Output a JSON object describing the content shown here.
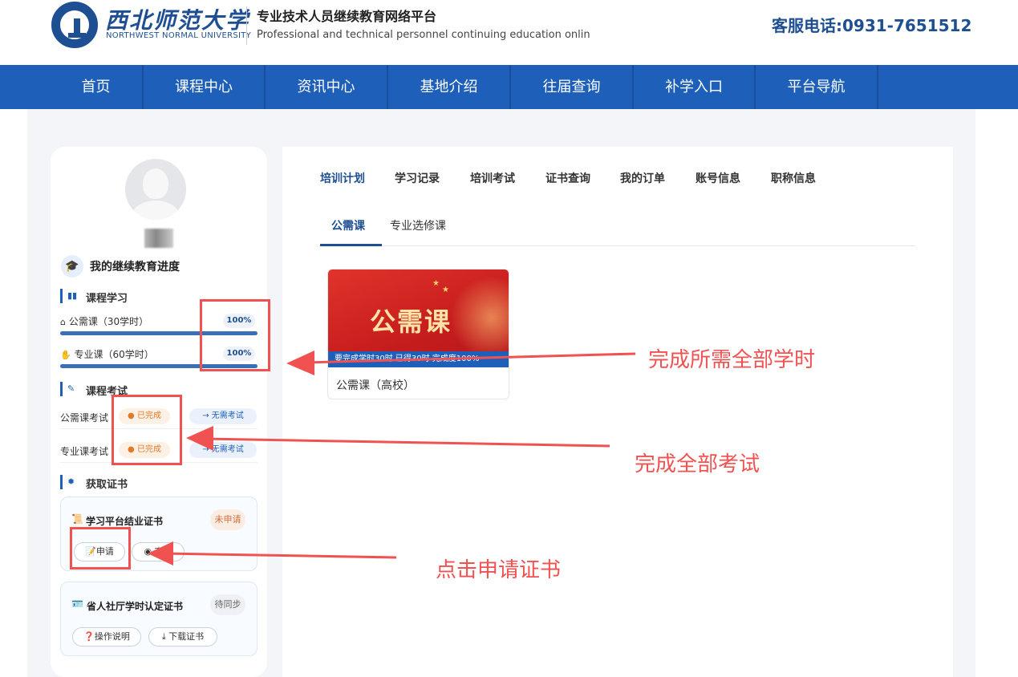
{
  "header": {
    "logo_name_cn": "西北师范大学",
    "logo_name_en": "NORTHWEST NORMAL UNIVERSITY",
    "platform_title_cn": "专业技术人员继续教育网络平台",
    "platform_title_en": "Professional and technical personnel continuing education onlin",
    "hotline": "客服电话:0931-7651512"
  },
  "nav": {
    "items": [
      {
        "label": "首页"
      },
      {
        "label": "课程中心"
      },
      {
        "label": "资讯中心"
      },
      {
        "label": "基地介绍"
      },
      {
        "label": "往届查询"
      },
      {
        "label": "补学入口"
      },
      {
        "label": "平台导航"
      }
    ]
  },
  "sidebar": {
    "progress_title": "我的继续教育进度",
    "course_section_title": "课程学习",
    "courses": [
      {
        "label": "公需课（30学时）",
        "percent_text": "100%",
        "progress": 1.0
      },
      {
        "label": "专业课（60学时）",
        "percent_text": "100%",
        "progress": 1.0
      }
    ],
    "exam_section_title": "课程考试",
    "exams": [
      {
        "label": "公需课考试",
        "status": "已完成",
        "action": "→ 无需考试"
      },
      {
        "label": "专业课考试",
        "status": "已完成",
        "action": "→ 无需考试"
      }
    ],
    "cert_section_title": "获取证书",
    "certificates": [
      {
        "title": "学习平台结业证书",
        "status": "未申请",
        "buttons": [
          "申请",
          "查看"
        ]
      },
      {
        "title": "省人社厅学时认定证书",
        "status": "待同步",
        "buttons": [
          "操作说明",
          "下载证书"
        ]
      }
    ]
  },
  "main": {
    "tabs": [
      "培训计划",
      "学习记录",
      "培训考试",
      "证书查询",
      "我的订单",
      "账号信息",
      "职称信息"
    ],
    "active_tab": "培训计划",
    "subtabs": [
      "公需课",
      "专业选修课"
    ],
    "active_subtab": "公需课",
    "course_card": {
      "banner_title": "公需课",
      "banner_strip": "要完成学时30时 已得30时 完成度100%",
      "name": "公需课（高校）"
    }
  },
  "annotations": [
    {
      "text": "完成所需全部学时"
    },
    {
      "text": "完成全部考试"
    },
    {
      "text": "点击申请证书"
    }
  ],
  "colors": {
    "brand_blue": "#1e5fba",
    "annotation_red": "#f05252",
    "done_orange": "#e07b2b"
  }
}
